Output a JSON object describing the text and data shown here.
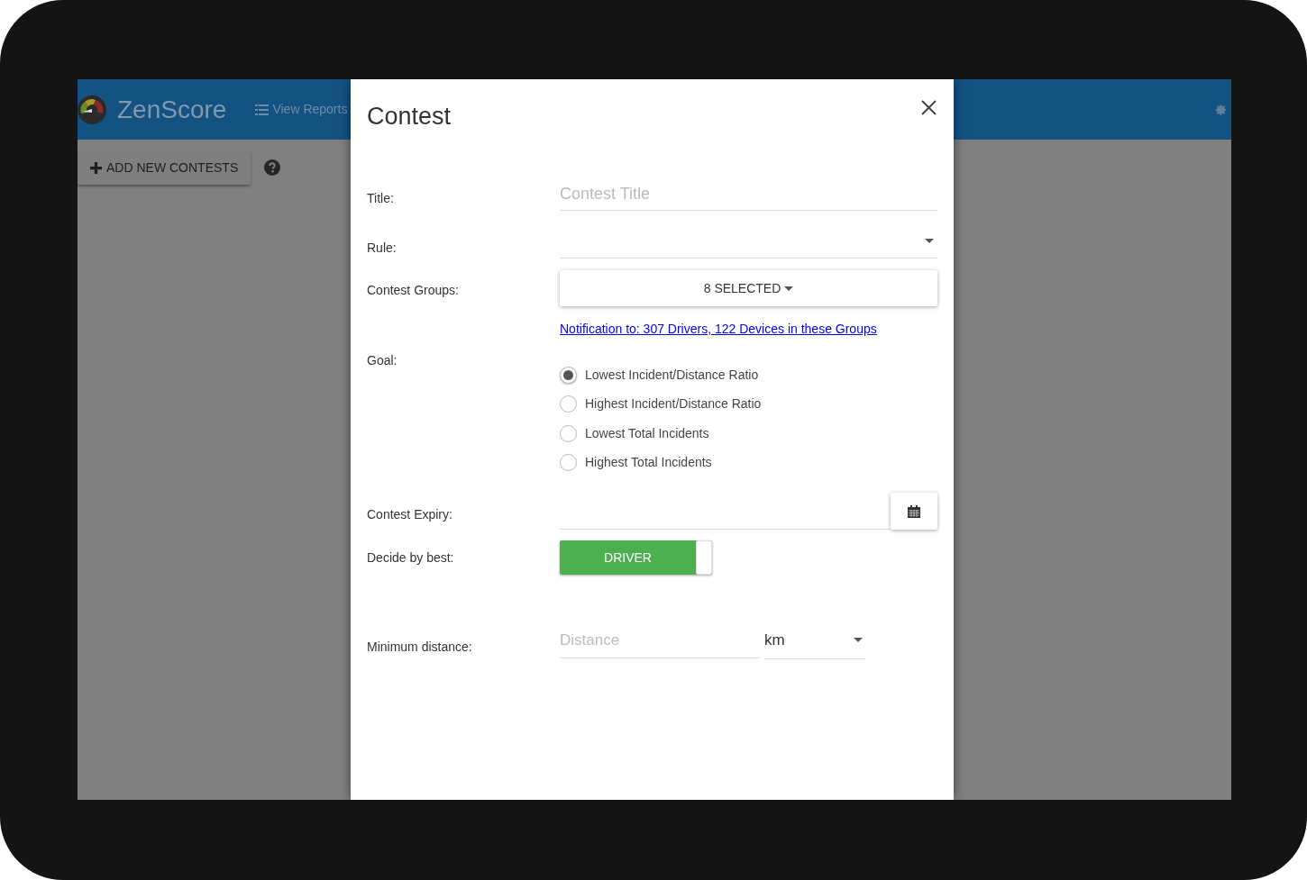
{
  "app": {
    "logo_text": "ZenScore",
    "nav": [
      {
        "label": "View Reports"
      }
    ]
  },
  "toolbar": {
    "add_button": "ADD NEW CONTESTS"
  },
  "modal": {
    "title": "Contest",
    "fields": [
      {
        "kind": "text",
        "label": "Title:",
        "placeholder": "Contest Title"
      },
      {
        "kind": "select",
        "label": "Rule:"
      },
      {
        "kind": "multiselect",
        "label": "Contest Groups:",
        "value": "8 SELECTED",
        "link": "Notification to: 307 Drivers, 122 Devices in these Groups"
      },
      {
        "kind": "radio",
        "label": "Goal:",
        "options": [
          {
            "label": "Lowest Incident/Distance Ratio",
            "selected": true
          },
          {
            "label": "Highest Incident/Distance Ratio",
            "selected": false
          },
          {
            "label": "Lowest Total Incidents",
            "selected": false
          },
          {
            "label": "Highest Total Incidents",
            "selected": false
          }
        ]
      },
      {
        "kind": "date",
        "label": "Contest Expiry:"
      },
      {
        "kind": "toggle",
        "label": "Decide by best:",
        "value": "DRIVER",
        "on": true
      },
      {
        "kind": "distance",
        "label": "Minimum distance:",
        "placeholder": "Distance",
        "unit": "km"
      }
    ]
  }
}
